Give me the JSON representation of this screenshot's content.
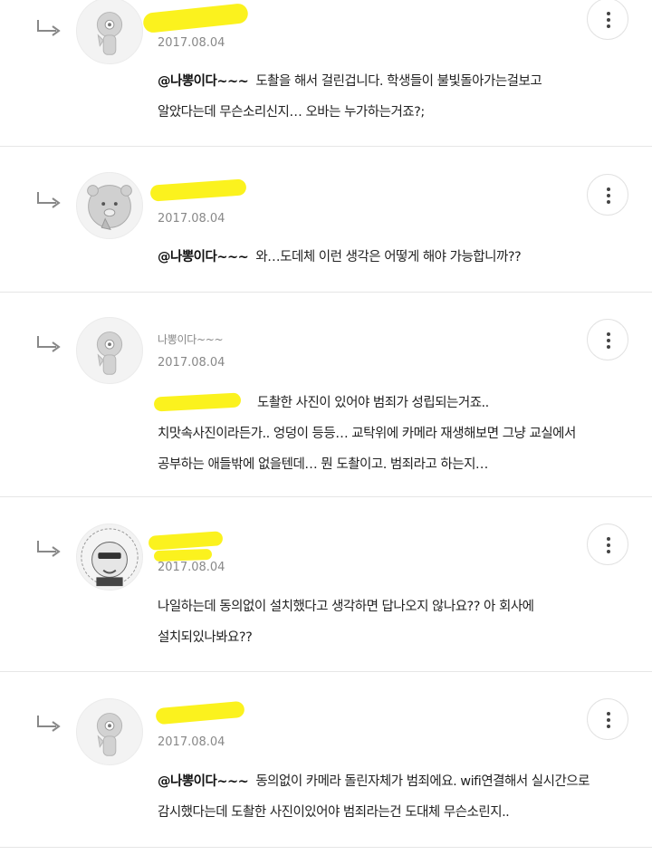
{
  "comments": [
    {
      "nickname": "",
      "date": "2017.08.04",
      "mention": "@나뽕이다~~~",
      "lines": [
        "도촬을 해서 걸린겁니다. 학생들이 불빛돌아가는걸보고",
        "알았다는데 무슨소리신지… 오바는 누가하는거죠?;"
      ]
    },
    {
      "nickname": "",
      "date": "2017.08.04",
      "mention": "@나뽕이다~~~",
      "lines": [
        "와…도데체 이런 생각은 어떻게 해야 가능합니까??"
      ]
    },
    {
      "nickname": "나뽕이다~~~",
      "date": "2017.08.04",
      "mention": "",
      "lines": [
        "도촬한 사진이 있어야 범죄가 성립되는거죠..",
        "치맛속사진이라든가.. 엉덩이 등등… 교탁위에 카메라 재생해보면 그냥 교실에서",
        "공부하는 애들밖에 없을텐데… 뭔 도촬이고. 범죄라고 하는지…"
      ]
    },
    {
      "nickname": "",
      "date": "2017.08.04",
      "mention": "",
      "lines": [
        "나일하는데 동의없이 설치했다고 생각하면 답나오지 않나요?? 아 회사에",
        "설치되있나봐요??"
      ]
    },
    {
      "nickname": "",
      "date": "2017.08.04",
      "mention": "@나뽕이다~~~",
      "lines": [
        "동의없이 카메라 돌린자체가 범죄에요. wifi연결해서 실시간으로",
        "감시했다는데 도촬한 사진이있어야 범죄라는건 도대체 무슨소린지.."
      ]
    }
  ],
  "icons": {
    "reply": "reply-arrow-icon",
    "more": "more-vertical-icon"
  },
  "colors": {
    "highlight": "#fbf21e",
    "meta": "#888888",
    "divider": "#e6e6e6"
  }
}
